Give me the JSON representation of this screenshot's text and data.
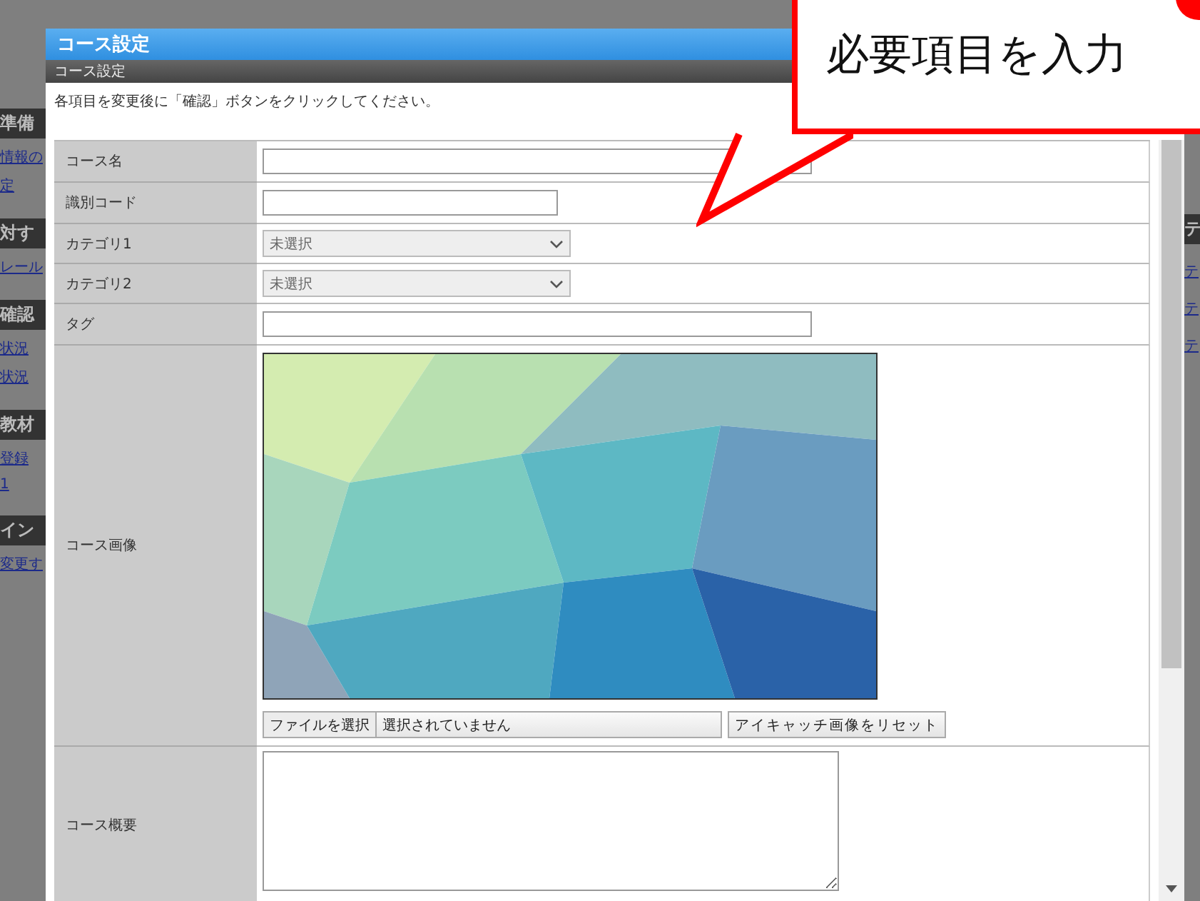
{
  "background_page": {
    "left_items": [
      {
        "kind": "heading",
        "text": "準備"
      },
      {
        "kind": "link",
        "text": "情報の"
      },
      {
        "kind": "link",
        "text": "定"
      },
      {
        "kind": "heading",
        "text": "対す"
      },
      {
        "kind": "link",
        "text": "レール"
      },
      {
        "kind": "heading",
        "text": "確認"
      },
      {
        "kind": "link",
        "text": "状況"
      },
      {
        "kind": "link",
        "text": "状況"
      },
      {
        "kind": "heading",
        "text": "教材"
      },
      {
        "kind": "link",
        "text": "登録"
      },
      {
        "kind": "link",
        "text": "1"
      },
      {
        "kind": "heading",
        "text": "イン"
      },
      {
        "kind": "link",
        "text": "変更す"
      }
    ],
    "right_items": [
      {
        "kind": "heading",
        "text": "テ"
      },
      {
        "kind": "link",
        "text": "テ"
      },
      {
        "kind": "link",
        "text": "テ"
      },
      {
        "kind": "link",
        "text": "テ"
      }
    ]
  },
  "dialog": {
    "title": "コース設定",
    "subtitle": "コース設定",
    "instruction": "各項目を変更後に「確認」ボタンをクリックしてください。",
    "rows": [
      {
        "label": "コース名",
        "kind": "longtext"
      },
      {
        "label": "識別コード",
        "kind": "shorttext"
      },
      {
        "label": "カテゴリ1",
        "kind": "select",
        "value": "未選択"
      },
      {
        "label": "カテゴリ2",
        "kind": "select",
        "value": "未選択"
      },
      {
        "label": "タグ",
        "kind": "longtext"
      },
      {
        "label": "コース画像",
        "file_button": "ファイルを選択",
        "file_status": "選択されていません",
        "reset_button": "アイキャッチ画像をリセット"
      },
      {
        "label": "コース概要",
        "kind": "textarea"
      }
    ]
  },
  "callout": {
    "text": "必要項目を入力"
  }
}
